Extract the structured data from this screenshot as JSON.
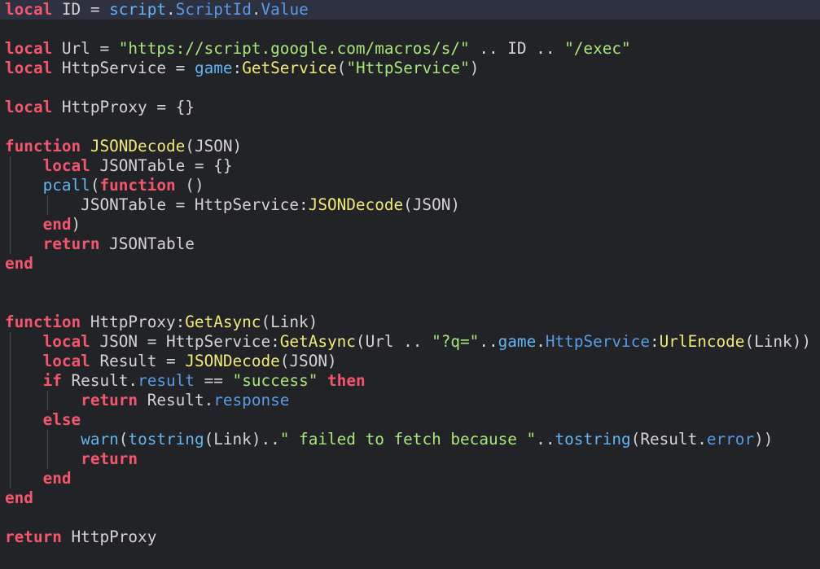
{
  "editor": {
    "language": "Lua",
    "current_line": 1,
    "colors": {
      "background": "#222327",
      "current_line_bg": "#2e3140",
      "keyword": "#f4566e",
      "function_name": "#f3e87a",
      "builtin": "#64b4f2",
      "property": "#5a9ae6",
      "string": "#a8e67c",
      "identifier": "#d4d4d4",
      "indent_guide": "#4a4d56"
    },
    "lines": [
      {
        "guides": 0,
        "tokens": [
          [
            "kw",
            "local"
          ],
          [
            "id",
            " ID = "
          ],
          [
            "bi",
            "script"
          ],
          [
            "id",
            "."
          ],
          [
            "pr",
            "ScriptId"
          ],
          [
            "id",
            "."
          ],
          [
            "pr",
            "Value"
          ]
        ]
      },
      {
        "guides": 0,
        "tokens": []
      },
      {
        "guides": 0,
        "tokens": [
          [
            "kw",
            "local"
          ],
          [
            "id",
            " Url = "
          ],
          [
            "str",
            "\"https://script.google.com/macros/s/\""
          ],
          [
            "id",
            " .. ID .. "
          ],
          [
            "str",
            "\"/exec\""
          ]
        ]
      },
      {
        "guides": 0,
        "tokens": [
          [
            "kw",
            "local"
          ],
          [
            "id",
            " HttpService = "
          ],
          [
            "bi",
            "game"
          ],
          [
            "id",
            ":"
          ],
          [
            "fn",
            "GetService"
          ],
          [
            "id",
            "("
          ],
          [
            "str",
            "\"HttpService\""
          ],
          [
            "id",
            ")"
          ]
        ]
      },
      {
        "guides": 0,
        "tokens": []
      },
      {
        "guides": 0,
        "tokens": [
          [
            "kw",
            "local"
          ],
          [
            "id",
            " HttpProxy = {}"
          ]
        ]
      },
      {
        "guides": 0,
        "tokens": []
      },
      {
        "guides": 0,
        "tokens": [
          [
            "kw",
            "function"
          ],
          [
            "id",
            " "
          ],
          [
            "fn",
            "JSONDecode"
          ],
          [
            "id",
            "(JSON)"
          ]
        ]
      },
      {
        "guides": 1,
        "tokens": [
          [
            "id",
            "    "
          ],
          [
            "kw",
            "local"
          ],
          [
            "id",
            " JSONTable = {}"
          ]
        ]
      },
      {
        "guides": 1,
        "tokens": [
          [
            "id",
            "    "
          ],
          [
            "bi",
            "pcall"
          ],
          [
            "id",
            "("
          ],
          [
            "kw",
            "function"
          ],
          [
            "id",
            " ()"
          ]
        ]
      },
      {
        "guides": 2,
        "tokens": [
          [
            "id",
            "        JSONTable = HttpService:"
          ],
          [
            "fn",
            "JSONDecode"
          ],
          [
            "id",
            "(JSON)"
          ]
        ]
      },
      {
        "guides": 1,
        "tokens": [
          [
            "id",
            "    "
          ],
          [
            "kw",
            "end"
          ],
          [
            "id",
            ")"
          ]
        ]
      },
      {
        "guides": 1,
        "tokens": [
          [
            "id",
            "    "
          ],
          [
            "kw",
            "return"
          ],
          [
            "id",
            " JSONTable"
          ]
        ]
      },
      {
        "guides": 0,
        "tokens": [
          [
            "kw",
            "end"
          ]
        ]
      },
      {
        "guides": 0,
        "tokens": []
      },
      {
        "guides": 0,
        "tokens": []
      },
      {
        "guides": 0,
        "tokens": [
          [
            "kw",
            "function"
          ],
          [
            "id",
            " HttpProxy:"
          ],
          [
            "fn",
            "GetAsync"
          ],
          [
            "id",
            "(Link)"
          ]
        ]
      },
      {
        "guides": 1,
        "tokens": [
          [
            "id",
            "    "
          ],
          [
            "kw",
            "local"
          ],
          [
            "id",
            " JSON = HttpService:"
          ],
          [
            "fn",
            "GetAsync"
          ],
          [
            "id",
            "(Url .. "
          ],
          [
            "str",
            "\"?q=\""
          ],
          [
            "id",
            ".."
          ],
          [
            "bi",
            "game"
          ],
          [
            "id",
            "."
          ],
          [
            "pr",
            "HttpService"
          ],
          [
            "id",
            ":"
          ],
          [
            "fn",
            "UrlEncode"
          ],
          [
            "id",
            "(Link))"
          ]
        ]
      },
      {
        "guides": 1,
        "tokens": [
          [
            "id",
            "    "
          ],
          [
            "kw",
            "local"
          ],
          [
            "id",
            " Result = "
          ],
          [
            "fn",
            "JSONDecode"
          ],
          [
            "id",
            "(JSON)"
          ]
        ]
      },
      {
        "guides": 1,
        "tokens": [
          [
            "id",
            "    "
          ],
          [
            "kw",
            "if"
          ],
          [
            "id",
            " Result."
          ],
          [
            "pr",
            "result"
          ],
          [
            "id",
            " == "
          ],
          [
            "str",
            "\"success\""
          ],
          [
            "id",
            " "
          ],
          [
            "kw",
            "then"
          ]
        ]
      },
      {
        "guides": 2,
        "tokens": [
          [
            "id",
            "        "
          ],
          [
            "kw",
            "return"
          ],
          [
            "id",
            " Result."
          ],
          [
            "pr",
            "response"
          ]
        ]
      },
      {
        "guides": 1,
        "tokens": [
          [
            "id",
            "    "
          ],
          [
            "kw",
            "else"
          ]
        ]
      },
      {
        "guides": 2,
        "tokens": [
          [
            "id",
            "        "
          ],
          [
            "bi",
            "warn"
          ],
          [
            "id",
            "("
          ],
          [
            "bi",
            "tostring"
          ],
          [
            "id",
            "(Link).."
          ],
          [
            "str",
            "\" failed to fetch because \""
          ],
          [
            "id",
            ".."
          ],
          [
            "bi",
            "tostring"
          ],
          [
            "id",
            "(Result."
          ],
          [
            "pr",
            "error"
          ],
          [
            "id",
            "))"
          ]
        ]
      },
      {
        "guides": 2,
        "tokens": [
          [
            "id",
            "        "
          ],
          [
            "kw",
            "return"
          ]
        ]
      },
      {
        "guides": 1,
        "tokens": [
          [
            "id",
            "    "
          ],
          [
            "kw",
            "end"
          ]
        ]
      },
      {
        "guides": 0,
        "tokens": [
          [
            "kw",
            "end"
          ]
        ]
      },
      {
        "guides": 0,
        "tokens": []
      },
      {
        "guides": 0,
        "tokens": [
          [
            "kw",
            "return"
          ],
          [
            "id",
            " HttpProxy"
          ]
        ]
      }
    ]
  }
}
